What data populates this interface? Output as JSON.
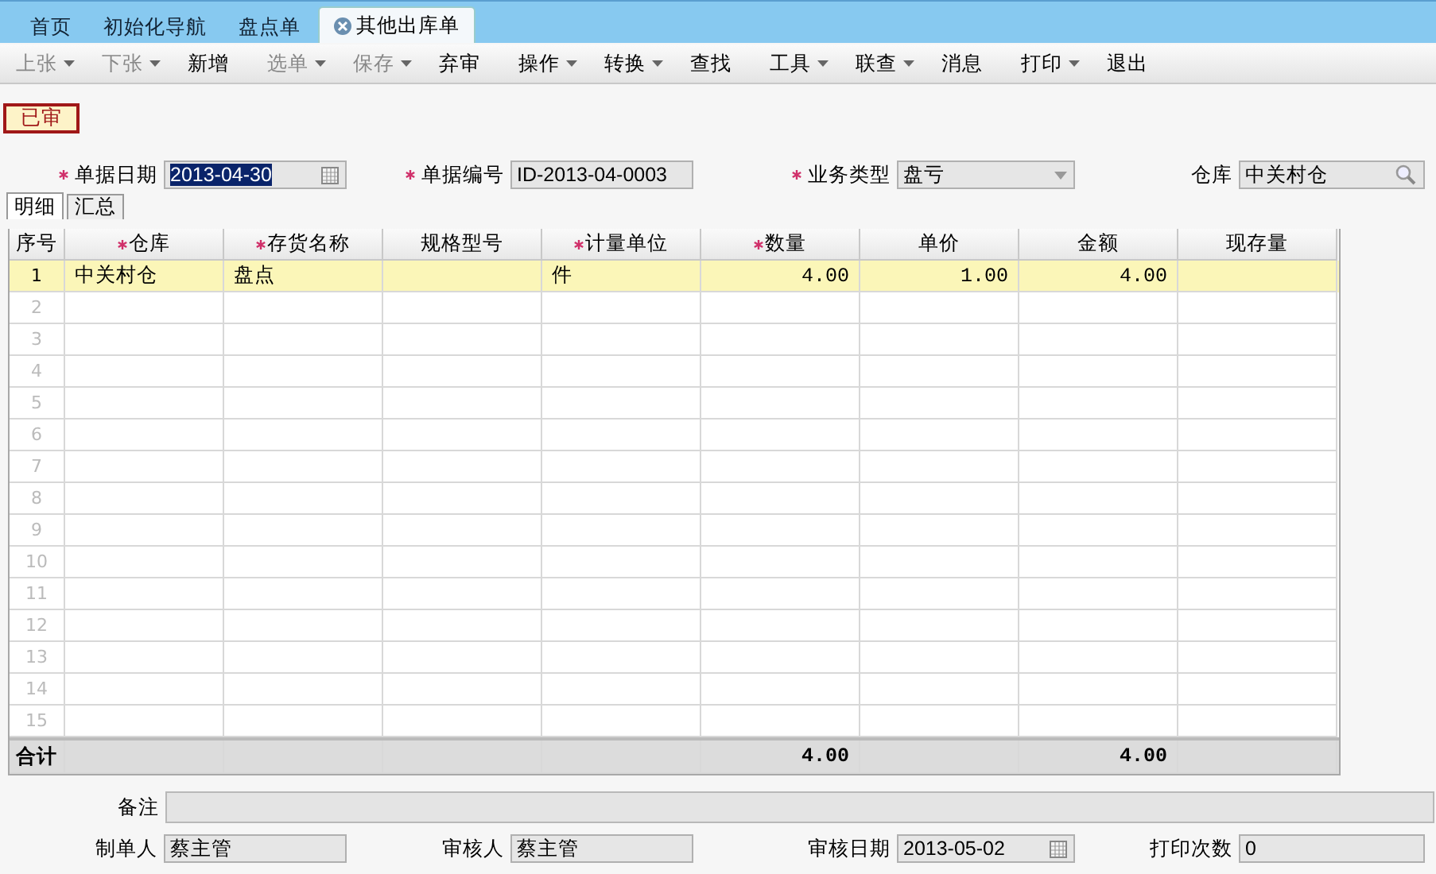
{
  "tabs": [
    {
      "label": "首页",
      "selected": false,
      "closable": false
    },
    {
      "label": "初始化导航",
      "selected": false,
      "closable": false
    },
    {
      "label": "盘点单",
      "selected": false,
      "closable": false
    },
    {
      "label": "其他出库单",
      "selected": true,
      "closable": true
    }
  ],
  "toolbar": [
    {
      "label": "上张",
      "disabled": true,
      "menu": true
    },
    {
      "label": "下张",
      "disabled": true,
      "menu": true
    },
    {
      "label": "新增",
      "disabled": false,
      "menu": false
    },
    {
      "label": "选单",
      "disabled": true,
      "menu": true
    },
    {
      "label": "保存",
      "disabled": true,
      "menu": true
    },
    {
      "label": "弃审",
      "disabled": false,
      "menu": false
    },
    {
      "label": "操作",
      "disabled": false,
      "menu": true
    },
    {
      "label": "转换",
      "disabled": false,
      "menu": true
    },
    {
      "label": "查找",
      "disabled": false,
      "menu": false
    },
    {
      "label": "工具",
      "disabled": false,
      "menu": true
    },
    {
      "label": "联查",
      "disabled": false,
      "menu": true
    },
    {
      "label": "消息",
      "disabled": false,
      "menu": false
    },
    {
      "label": "打印",
      "disabled": false,
      "menu": true
    },
    {
      "label": "退出",
      "disabled": false,
      "menu": false
    }
  ],
  "status_stamp": "已审",
  "header_fields": [
    {
      "label": "单据日期",
      "required": true,
      "value": "2013-04-30",
      "kind": "date",
      "selected": true
    },
    {
      "label": "单据编号",
      "required": true,
      "value": "ID-2013-04-0003",
      "kind": "text",
      "selected": false
    },
    {
      "label": "业务类型",
      "required": true,
      "value": "盘亏",
      "kind": "select",
      "selected": false
    },
    {
      "label": "仓库",
      "required": false,
      "value": "中关村仓",
      "kind": "lookup",
      "selected": false
    }
  ],
  "sub_tabs": [
    {
      "label": "明细",
      "selected": true
    },
    {
      "label": "汇总",
      "selected": false
    }
  ],
  "table": {
    "columns": [
      {
        "label": "序号",
        "required": false,
        "kind": "index"
      },
      {
        "label": "仓库",
        "required": true,
        "kind": "text"
      },
      {
        "label": "存货名称",
        "required": true,
        "kind": "text"
      },
      {
        "label": "规格型号",
        "required": false,
        "kind": "text"
      },
      {
        "label": "计量单位",
        "required": true,
        "kind": "text"
      },
      {
        "label": "数量",
        "required": true,
        "kind": "number"
      },
      {
        "label": "单价",
        "required": false,
        "kind": "number"
      },
      {
        "label": "金额",
        "required": false,
        "kind": "number"
      },
      {
        "label": "现存量",
        "required": false,
        "kind": "number"
      }
    ],
    "rows": [
      {
        "selected": true,
        "cells": [
          "1",
          "中关村仓",
          "盘点",
          null,
          "件",
          "4.00",
          "1.00",
          "4.00",
          null
        ]
      },
      {
        "selected": false,
        "cells": [
          "2",
          null,
          null,
          null,
          null,
          null,
          null,
          null,
          null
        ]
      },
      {
        "selected": false,
        "cells": [
          "3",
          null,
          null,
          null,
          null,
          null,
          null,
          null,
          null
        ]
      },
      {
        "selected": false,
        "cells": [
          "4",
          null,
          null,
          null,
          null,
          null,
          null,
          null,
          null
        ]
      },
      {
        "selected": false,
        "cells": [
          "5",
          null,
          null,
          null,
          null,
          null,
          null,
          null,
          null
        ]
      },
      {
        "selected": false,
        "cells": [
          "6",
          null,
          null,
          null,
          null,
          null,
          null,
          null,
          null
        ]
      },
      {
        "selected": false,
        "cells": [
          "7",
          null,
          null,
          null,
          null,
          null,
          null,
          null,
          null
        ]
      },
      {
        "selected": false,
        "cells": [
          "8",
          null,
          null,
          null,
          null,
          null,
          null,
          null,
          null
        ]
      },
      {
        "selected": false,
        "cells": [
          "9",
          null,
          null,
          null,
          null,
          null,
          null,
          null,
          null
        ]
      },
      {
        "selected": false,
        "cells": [
          "10",
          null,
          null,
          null,
          null,
          null,
          null,
          null,
          null
        ]
      },
      {
        "selected": false,
        "cells": [
          "11",
          null,
          null,
          null,
          null,
          null,
          null,
          null,
          null
        ]
      },
      {
        "selected": false,
        "cells": [
          "12",
          null,
          null,
          null,
          null,
          null,
          null,
          null,
          null
        ]
      },
      {
        "selected": false,
        "cells": [
          "13",
          null,
          null,
          null,
          null,
          null,
          null,
          null,
          null
        ]
      },
      {
        "selected": false,
        "cells": [
          "14",
          null,
          null,
          null,
          null,
          null,
          null,
          null,
          null
        ]
      },
      {
        "selected": false,
        "cells": [
          "15",
          null,
          null,
          null,
          null,
          null,
          null,
          null,
          null
        ]
      }
    ],
    "totals": {
      "label": "合计",
      "quantity": "4.00",
      "amount": "4.00"
    }
  },
  "remark": {
    "label": "备注"
  },
  "footer_fields": [
    {
      "label": "制单人",
      "value": "蔡主管",
      "kind": "text"
    },
    {
      "label": "审核人",
      "value": "蔡主管",
      "kind": "text"
    },
    {
      "label": "审核日期",
      "value": "2013-05-02",
      "kind": "date"
    },
    {
      "label": "打印次数",
      "value": "0",
      "kind": "text"
    }
  ]
}
